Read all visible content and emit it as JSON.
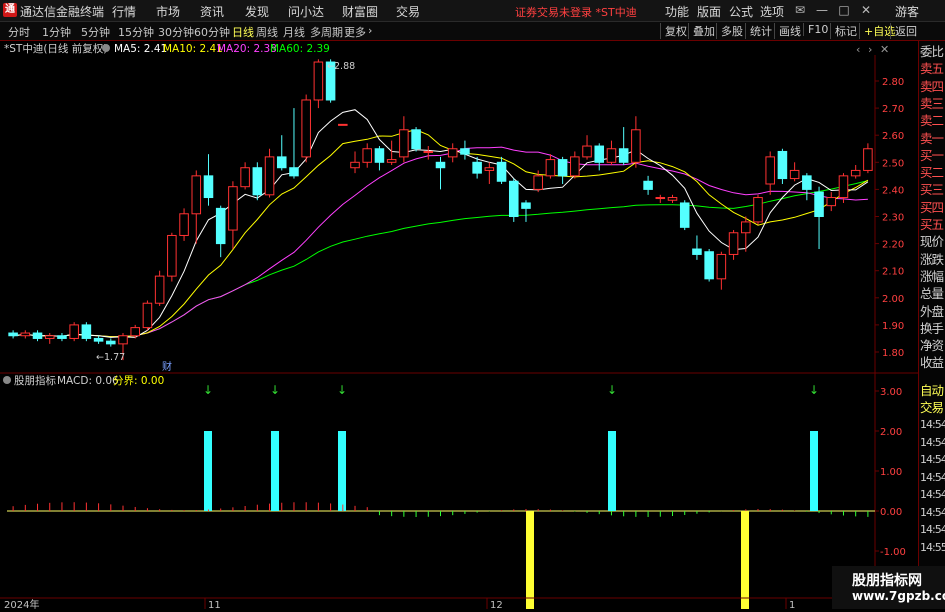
{
  "titlebar": {
    "app_title": "通达信金融终端",
    "menus": [
      "行情",
      "市场",
      "资讯",
      "发现",
      "问小达",
      "财富圈",
      "交易"
    ],
    "notice": "证券交易未登录 *ST中迪",
    "right_menus": [
      "功能",
      "版面",
      "公式",
      "选项"
    ],
    "guest": "游客"
  },
  "toolbar": {
    "periods": [
      "分时",
      "1分钟",
      "5分钟",
      "15分钟",
      "30分钟",
      "60分钟",
      "日线",
      "周线",
      "月线",
      "多周期",
      "更多"
    ],
    "active_period": "日线",
    "right_buttons": [
      "复权",
      "叠加",
      "多股",
      "统计",
      "画线",
      "F10",
      "标记",
      "+自选",
      "返回"
    ]
  },
  "main_chart": {
    "title": "*ST中迪(日线 前复权)",
    "ma5_label": "MA5: 2.41",
    "ma10_label": "MA10: 2.41",
    "ma20_label": "MA20: 2.38",
    "ma60_label": "MA60: 2.39",
    "high_label": "2.88",
    "low_label": "1.77",
    "fin_marker": "财",
    "y_ticks": [
      "2.80",
      "2.70",
      "2.60",
      "2.50",
      "2.40",
      "2.30",
      "2.20",
      "2.10",
      "2.00",
      "1.90",
      "1.80"
    ],
    "colors": {
      "up": "#ff3232",
      "down": "#54ffff",
      "ma5": "#ffffff",
      "ma10": "#ffff00",
      "ma20": "#ff40ff",
      "ma60": "#00ff00"
    }
  },
  "indicator": {
    "title": "股朋指标",
    "macd_label": "MACD: 0.06",
    "boundary_label": "分界: 0.00",
    "y_ticks": [
      "3.00",
      "2.00",
      "1.00",
      "0.00",
      "-1.00"
    ]
  },
  "x_axis": {
    "labels": [
      "2024年",
      "11",
      "12",
      "1"
    ]
  },
  "right_panel": {
    "items": [
      "委比",
      "卖五",
      "卖四",
      "卖三",
      "卖二",
      "卖一",
      "买一",
      "买二",
      "买三",
      "买四",
      "买五",
      "现价",
      "涨跌",
      "涨幅",
      "总量",
      "外盘",
      "换手",
      "净资",
      "收益"
    ],
    "trade_items": [
      "自动",
      "交易"
    ],
    "times": [
      "14:54",
      "14:54",
      "14:54",
      "14:54",
      "14:54",
      "14:54",
      "14:54",
      "14:55"
    ]
  },
  "watermark": {
    "line1": "股朋指标网",
    "line2": "www.7gpzb.com"
  }
}
